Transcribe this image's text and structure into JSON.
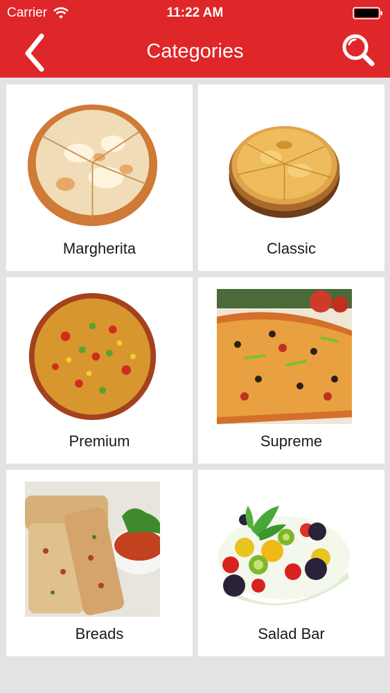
{
  "status_bar": {
    "carrier": "Carrier",
    "time": "11:22 AM"
  },
  "nav": {
    "title": "Categories",
    "back_icon": "chevron-left-icon",
    "search_icon": "search-icon"
  },
  "colors": {
    "brand": "#df2629",
    "background": "#e3e3e5",
    "card": "#ffffff"
  },
  "categories": [
    {
      "label": "Margherita",
      "image": "margherita-pizza-image"
    },
    {
      "label": "Classic",
      "image": "classic-pizza-image"
    },
    {
      "label": "Premium",
      "image": "premium-pizza-image"
    },
    {
      "label": "Supreme",
      "image": "supreme-pizza-image"
    },
    {
      "label": "Breads",
      "image": "breads-image"
    },
    {
      "label": "Salad Bar",
      "image": "salad-bar-image"
    }
  ]
}
